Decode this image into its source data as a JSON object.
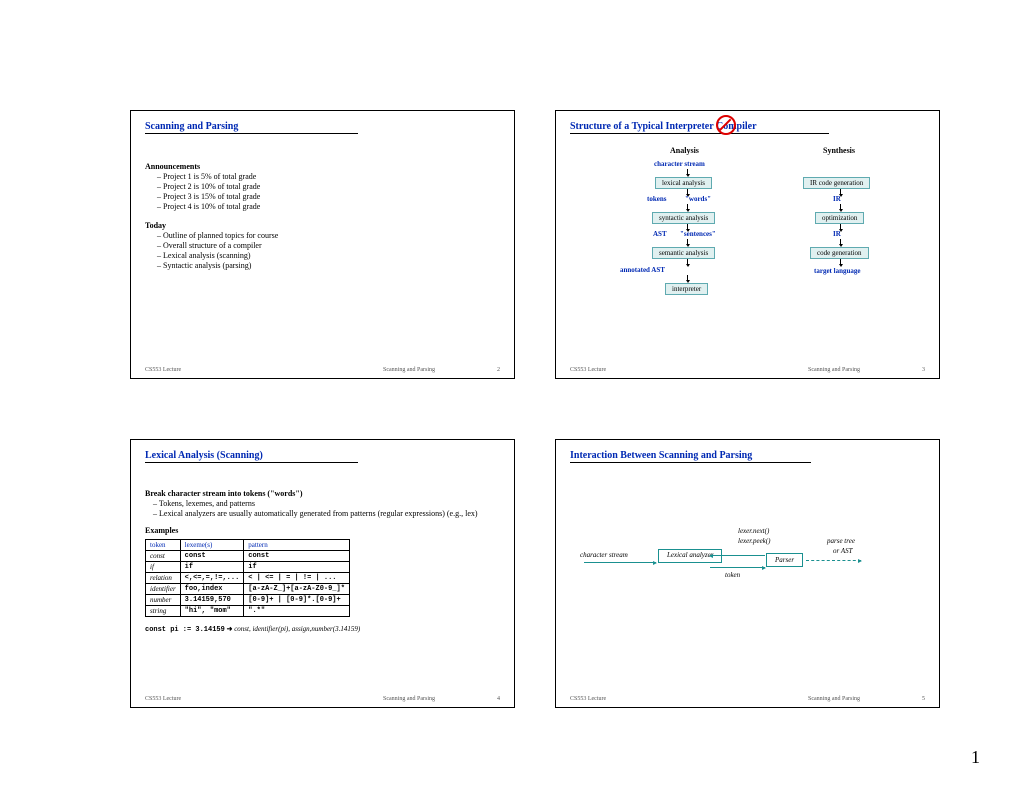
{
  "page_number": "1",
  "slides": {
    "s1": {
      "title": "Scanning and Parsing",
      "ann_head": "Announcements",
      "ann": [
        "Project 1 is 5% of total grade",
        "Project 2 is 10% of total grade",
        "Project 3 is 15% of total grade",
        "Project 4 is 10% of total grade"
      ],
      "today_head": "Today",
      "today": [
        "Outline of planned topics for course",
        "Overall structure of a compiler",
        "Lexical analysis (scanning)",
        "Syntactic analysis (parsing)"
      ],
      "footer": {
        "left": "CS553 Lecture",
        "mid": "Scanning and Parsing",
        "num": "2"
      }
    },
    "s2": {
      "title": "Structure of a Typical Interpreter    Compiler",
      "col1": "Analysis",
      "col2": "Synthesis",
      "labels": {
        "charstream": "character stream",
        "lex": "lexical analysis",
        "tokens": "tokens",
        "words": "\"words\"",
        "syn": "syntactic analysis",
        "ast": "AST",
        "sent": "\"sentences\"",
        "sem": "semantic analysis",
        "annot": "annotated AST",
        "interp": "interpreter",
        "irgen": "IR code generation",
        "ir1": "IR",
        "opt": "optimization",
        "ir2": "IR",
        "codegen": "code generation",
        "target": "target language"
      },
      "footer": {
        "left": "CS553 Lecture",
        "mid": "Scanning and Parsing",
        "num": "3"
      }
    },
    "s3": {
      "title": "Lexical Analysis (Scanning)",
      "head": "Break character stream into tokens (\"words\")",
      "bullets": [
        "Tokens, lexemes, and patterns",
        "Lexical analyzers are usually automatically generated from patterns (regular expressions) (e.g., lex)"
      ],
      "examples_head": "Examples",
      "table": {
        "headers": [
          "token",
          "lexeme(s)",
          "pattern"
        ],
        "rows": [
          [
            "const",
            "const",
            "const"
          ],
          [
            "if",
            "if",
            "if"
          ],
          [
            "relation",
            "<,<=,=,!=,...",
            "< | <= | = | != | ..."
          ],
          [
            "identifier",
            "foo,index",
            "[a-zA-Z_]+[a-zA-Z0-9_]*"
          ],
          [
            "number",
            "3.14159,570",
            "[0-9]+ | [0-9]*.[0-9]+"
          ],
          [
            "string",
            "\"hi\", \"mom\"",
            "\".*\""
          ]
        ]
      },
      "example_prefix": "const pi := 3.14159",
      "example_arrow": "➜",
      "example_suffix": "const, identifier(pi), assign,number(3.14159)",
      "footer": {
        "left": "CS553 Lecture",
        "mid": "Scanning and Parsing",
        "num": "4"
      }
    },
    "s4": {
      "title": "Interaction Between Scanning and Parsing",
      "labels": {
        "charstream": "character stream",
        "lexbox": "Lexical analyzer",
        "next": "lexer.next()",
        "peek": "lexer.peek()",
        "token": "token",
        "parser": "Parser",
        "parsetree": "parse tree",
        "orast": "or AST"
      },
      "footer": {
        "left": "CS553 Lecture",
        "mid": "Scanning and Parsing",
        "num": "5"
      }
    }
  }
}
